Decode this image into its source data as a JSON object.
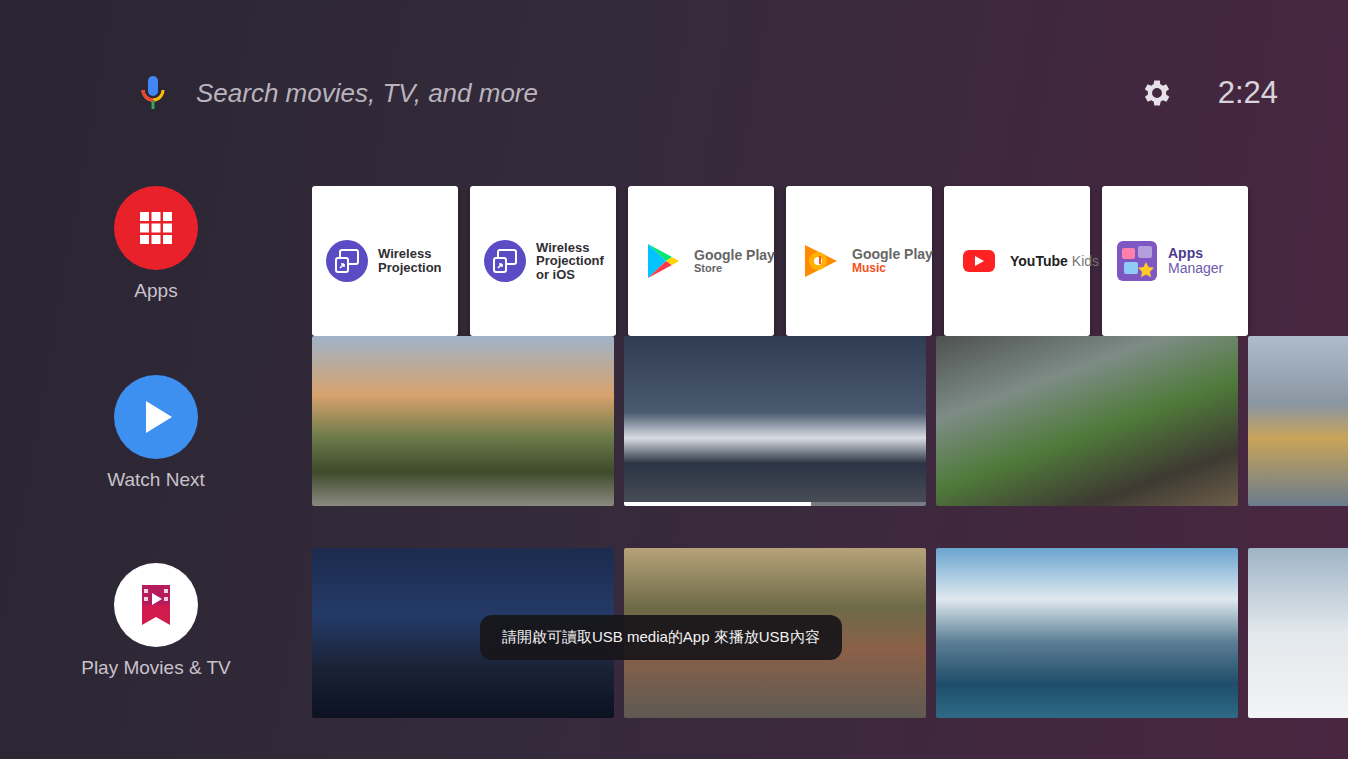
{
  "search": {
    "text": "Search movies, TV, and more"
  },
  "clock": "2:24",
  "channels": [
    {
      "label": "Apps",
      "kind": "apps",
      "tiles": [
        {
          "kind": "projection",
          "lines": [
            "Wireless",
            "Projection"
          ]
        },
        {
          "kind": "projection",
          "lines": [
            "Wireless",
            "Projectionf",
            "or iOS"
          ]
        },
        {
          "kind": "playstore",
          "lines": [
            "Google Play",
            "Store"
          ]
        },
        {
          "kind": "playmusic",
          "lines": [
            "Google Play",
            "Music"
          ]
        },
        {
          "kind": "youtubekids",
          "lines": [
            "YouTube",
            "Kids"
          ]
        },
        {
          "kind": "appsmanager",
          "lines": [
            "Apps",
            "Manager"
          ]
        }
      ]
    },
    {
      "label": "Watch Next",
      "kind": "watch",
      "photos": [
        {},
        {
          "level": 0.62
        },
        {},
        {}
      ]
    },
    {
      "label": "Play Movies & TV",
      "kind": "movies",
      "photos": [
        {},
        {},
        {},
        {}
      ]
    }
  ],
  "toast": "請開啟可讀取USB media的App 來播放USB內容"
}
